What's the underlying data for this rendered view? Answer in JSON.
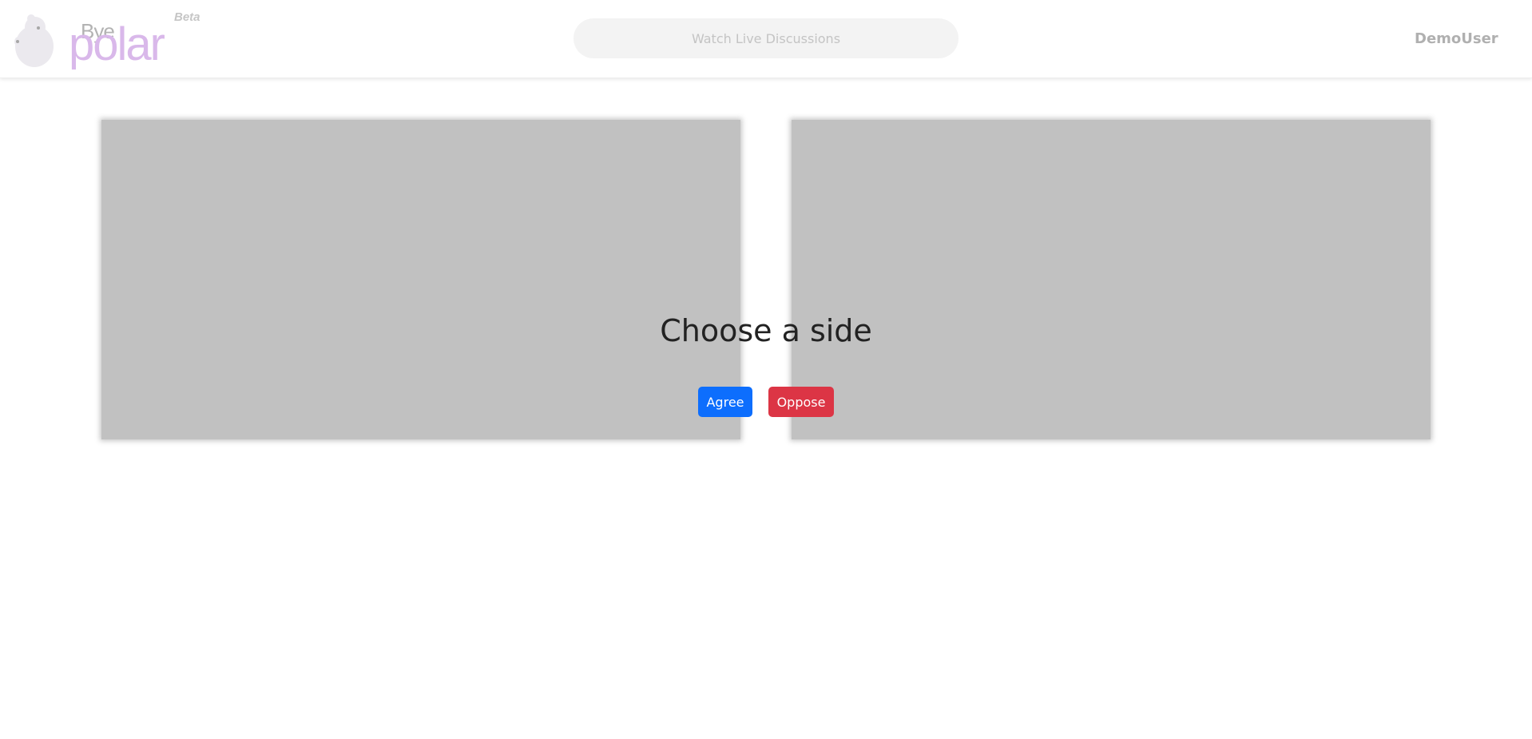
{
  "brand": {
    "bye": "Bye",
    "polar": "polar",
    "beta": "Beta"
  },
  "search": {
    "placeholder": "Watch Live Discussions"
  },
  "user": {
    "name": "DemoUser"
  },
  "main": {
    "heading": "Choose a side",
    "agree_label": "Agree",
    "oppose_label": "Oppose"
  },
  "colors": {
    "agree": "#0d6efd",
    "oppose": "#dc3545",
    "logo_polar": "#d9b8ea",
    "video_placeholder": "#c1c1c1"
  }
}
